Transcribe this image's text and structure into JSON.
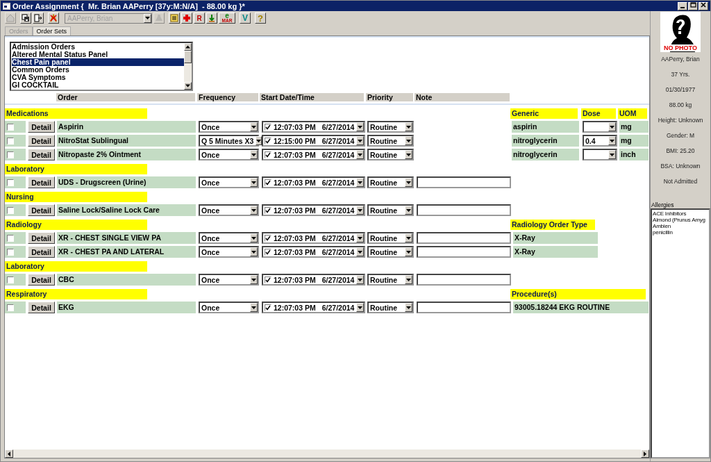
{
  "window": {
    "title": "Order Assignment {  Mr. Brian AAPerry [37y:M:N/A]  - 88.00 kg }*"
  },
  "toolbar": {
    "buttons": [
      {
        "kind": "home",
        "disabled": true
      },
      {
        "kind": "save",
        "disabled": false
      },
      {
        "kind": "exit",
        "disabled": false
      },
      {
        "kind": "cancel",
        "disabled": false
      }
    ],
    "patient_select": {
      "value": "AAPerry, Brian",
      "disabled": true
    },
    "buttons_2": [
      {
        "kind": "find",
        "disabled": true
      },
      {
        "kind": "bars",
        "disabled": false
      },
      {
        "kind": "cross",
        "disabled": false
      },
      {
        "kind": "rx",
        "glyph": "R",
        "disabled": false
      },
      {
        "kind": "arrow",
        "disabled": false
      },
      {
        "kind": "emar",
        "glyph": "e",
        "sub": "MAR",
        "disabled": false
      },
      {
        "kind": "letter",
        "glyph": "V",
        "disabled": false
      },
      {
        "kind": "help",
        "glyph": "?",
        "disabled": false
      }
    ]
  },
  "tabs": [
    {
      "label": "Orders",
      "selected": false
    },
    {
      "label": "Order Sets",
      "selected": true
    }
  ],
  "order_sets": {
    "items": [
      {
        "label": "Admission Orders",
        "selected": false
      },
      {
        "label": "Altered Mental Status Panel",
        "selected": false
      },
      {
        "label": "Chest Pain panel",
        "selected": true
      },
      {
        "label": "Common Orders",
        "selected": false
      },
      {
        "label": "CVA Symptoms",
        "selected": false
      },
      {
        "label": "GI COCKTAIL",
        "selected": false
      }
    ]
  },
  "columns": [
    "Order",
    "Frequency",
    "Start Date/Time",
    "Priority",
    "Note"
  ],
  "sections": [
    {
      "title": "Medications",
      "kind": "medication",
      "columns": [
        "Generic",
        "Dose",
        "UOM"
      ],
      "orders": [
        {
          "checked": false,
          "detail": "Detail",
          "name": "Aspirin",
          "frequency": "Once",
          "start_checked": true,
          "time": "12:07:03 PM",
          "date": "6/27/2014",
          "priority": "Routine",
          "generic": "aspirin",
          "uom": "mg"
        },
        {
          "checked": false,
          "detail": "Detail",
          "name": "NitroStat Sublingual",
          "frequency": "Q 5 Minutes X3",
          "start_checked": true,
          "time": "12:15:00 PM",
          "date": "6/27/2014",
          "priority": "Routine",
          "generic": "nitroglycerin",
          "dose": "0.4",
          "uom": "mg"
        },
        {
          "checked": false,
          "detail": "Detail",
          "name": "Nitropaste 2% Ointment",
          "frequency": "Once",
          "start_checked": true,
          "time": "12:07:03 PM",
          "date": "6/27/2014",
          "priority": "Routine",
          "generic": "nitroglycerin",
          "uom": "inch"
        }
      ]
    },
    {
      "title": "Laboratory",
      "kind": "plain",
      "orders": [
        {
          "checked": false,
          "detail": "Detail",
          "name": "UDS - Drugscreen (Urine)",
          "frequency": "Once",
          "start_checked": true,
          "time": "12:07:03 PM",
          "date": "6/27/2014",
          "priority": "Routine"
        }
      ]
    },
    {
      "title": "Nursing",
      "kind": "plain",
      "orders": [
        {
          "checked": false,
          "detail": "Detail",
          "name": "Saline Lock/Saline Lock Care",
          "frequency": "Once",
          "start_checked": true,
          "time": "12:07:03 PM",
          "date": "6/27/2014",
          "priority": "Routine"
        }
      ]
    },
    {
      "title": "Radiology",
      "kind": "radiology",
      "columns": [
        "Radiology Order Type"
      ],
      "orders": [
        {
          "checked": false,
          "detail": "Detail",
          "name": "XR - CHEST SINGLE VIEW PA",
          "frequency": "Once",
          "start_checked": true,
          "time": "12:07:03 PM",
          "date": "6/27/2014",
          "priority": "Routine",
          "order_type": "X-Ray"
        },
        {
          "checked": false,
          "detail": "Detail",
          "name": "XR - CHEST PA AND LATERAL",
          "frequency": "Once",
          "start_checked": true,
          "time": "12:07:03 PM",
          "date": "6/27/2014",
          "priority": "Routine",
          "order_type": "X-Ray"
        }
      ]
    },
    {
      "title": "Laboratory",
      "kind": "plain",
      "orders": [
        {
          "checked": false,
          "detail": "Detail",
          "name": "CBC",
          "frequency": "Once",
          "start_checked": true,
          "time": "12:07:03 PM",
          "date": "6/27/2014",
          "priority": "Routine"
        }
      ]
    },
    {
      "title": "Respiratory",
      "kind": "procedure",
      "columns": [
        "Procedure(s)"
      ],
      "orders": [
        {
          "checked": false,
          "detail": "Detail",
          "name": "EKG",
          "frequency": "Once",
          "start_checked": true,
          "time": "12:07:03 PM",
          "date": "6/27/2014",
          "priority": "Routine",
          "procedure": "93005.18244 EKG ROUTINE"
        }
      ]
    }
  ],
  "patient": {
    "photo_label": "NO PHOTO",
    "lines": [
      "AAPerry, Brian",
      "37 Yrs.",
      "01/30/1977",
      "88.00 kg",
      "Height: Unknown",
      "Gender: M",
      "BMI: 25.20",
      "BSA: Unknown",
      "Not Admitted"
    ]
  },
  "allergies": {
    "label": "Allergies",
    "items": [
      "ACE Inhibitors",
      "Almond (Prunus Amyg",
      "Ambien",
      "penicillin"
    ]
  }
}
